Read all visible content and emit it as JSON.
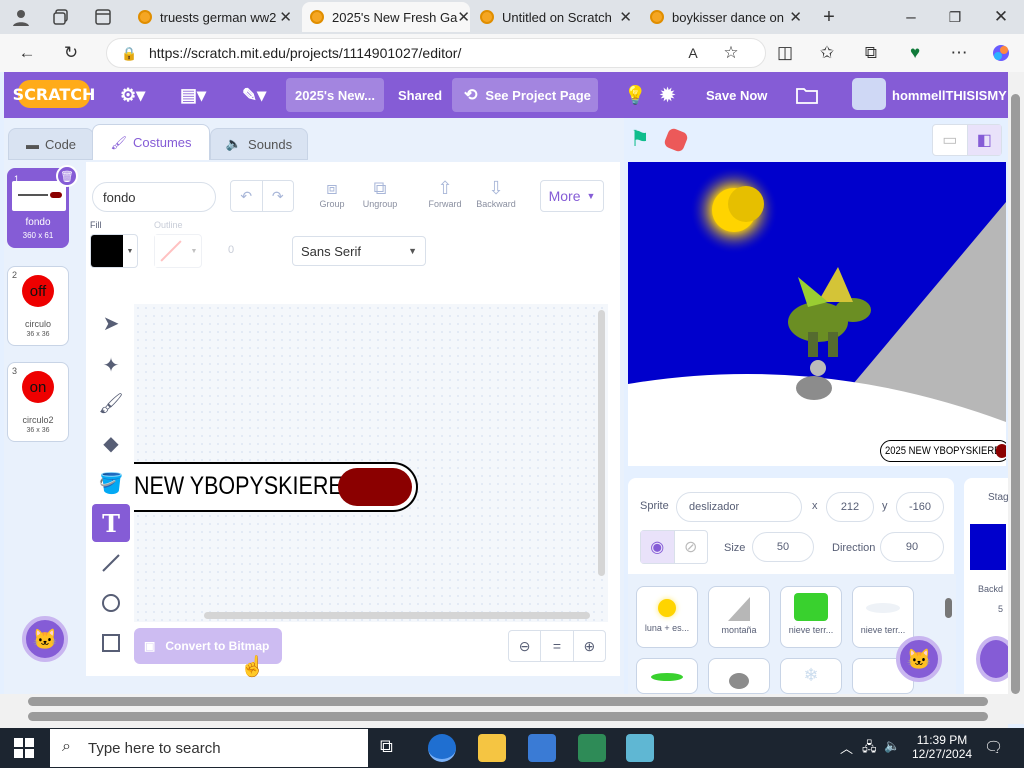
{
  "browser": {
    "tabs": [
      {
        "label": "truests german ww2",
        "active": false
      },
      {
        "label": "2025's New Fresh Ga",
        "active": true
      },
      {
        "label": "Untitled on Scratch",
        "active": false
      },
      {
        "label": "boykisser dance on",
        "active": false
      }
    ],
    "url": "https://scratch.mit.edu/projects/1114901027/editor/"
  },
  "menubar": {
    "logo": "SCRATCH",
    "project_title": "2025's New...",
    "shared_label": "Shared",
    "see_project_label": "See Project Page",
    "save_label": "Save Now",
    "username": "hommellTHISISMY"
  },
  "editor_tabs": {
    "code": "Code",
    "costumes": "Costumes",
    "sounds": "Sounds"
  },
  "costumes": [
    {
      "num": "1",
      "name": "fondo",
      "size": "360 x 61",
      "selected": true
    },
    {
      "num": "2",
      "name": "circulo",
      "size": "36 x 36",
      "thumb": "off"
    },
    {
      "num": "3",
      "name": "circulo2",
      "size": "36 x 36",
      "thumb": "on"
    }
  ],
  "paint": {
    "costume_name": "fondo",
    "fill_label": "Fill",
    "outline_label": "Outline",
    "outline_value": "0",
    "font": "Sans Serif",
    "group": "Group",
    "ungroup": "Ungroup",
    "forward": "Forward",
    "backward": "Backward",
    "more": "More",
    "canvas_text": "NEW YBOPYSKIERE:",
    "convert_label": "Convert to Bitmap",
    "zoom_reset": "="
  },
  "stage": {
    "banner_text": "2025 NEW YBOPYSKIERE:"
  },
  "sprite_info": {
    "sprite_label": "Sprite",
    "sprite_name": "deslizador",
    "x_label": "x",
    "x": "212",
    "y_label": "y",
    "y": "-160",
    "size_label": "Size",
    "size": "50",
    "direction_label": "Direction",
    "direction": "90",
    "stage_label": "Stag",
    "backdrops_label": "Backd",
    "backdrops_count": "5"
  },
  "sprites": [
    {
      "name": "luna + es..."
    },
    {
      "name": "montaña"
    },
    {
      "name": "nieve terr..."
    },
    {
      "name": "nieve terr..."
    }
  ],
  "taskbar": {
    "search_placeholder": "Type here to search",
    "time": "11:39 PM",
    "date": "12/27/2024",
    "notifications": "2"
  },
  "colors": {
    "accent": "#855cd6",
    "stage_bg": "#0000cc",
    "pill": "#8b0000"
  }
}
